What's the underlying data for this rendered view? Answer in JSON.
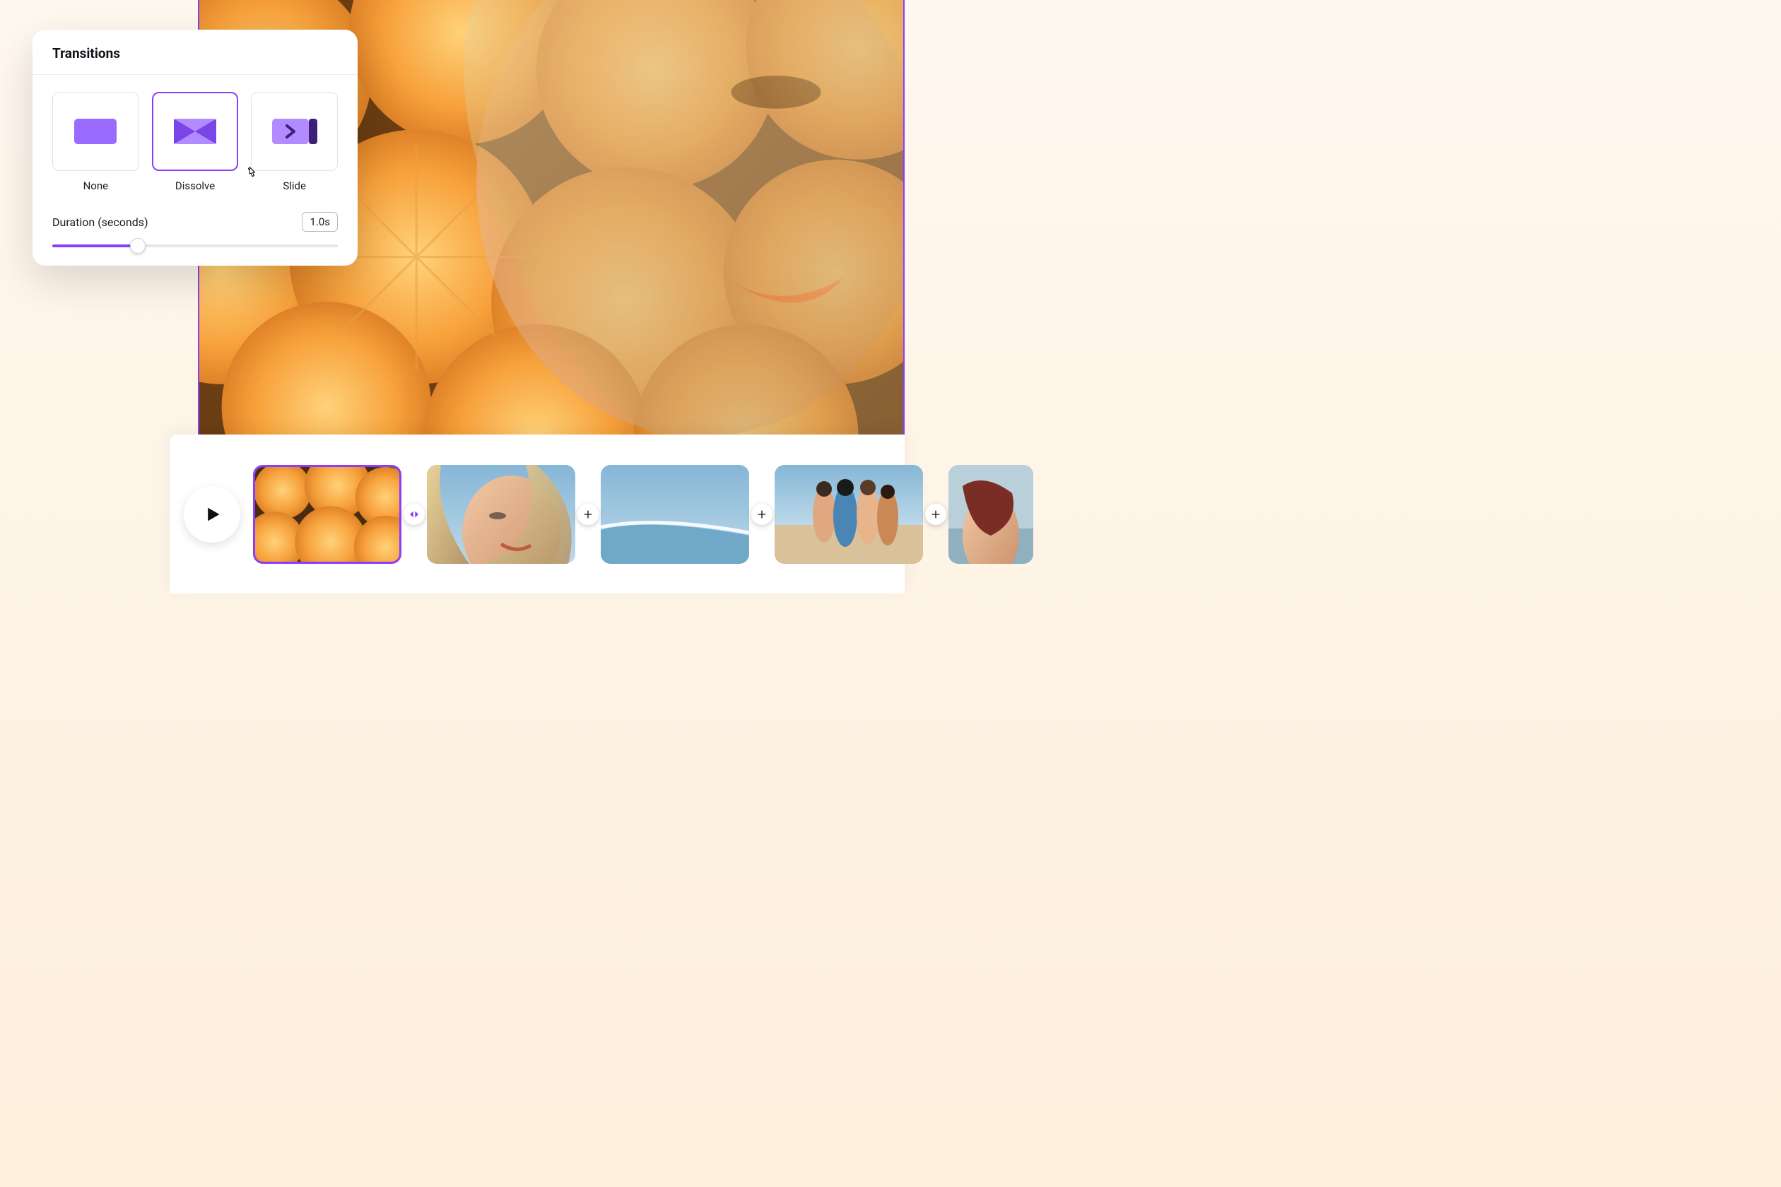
{
  "popover": {
    "title": "Transitions",
    "options": [
      {
        "label": "None",
        "selected": false
      },
      {
        "label": "Dissolve",
        "selected": true
      },
      {
        "label": "Slide",
        "selected": false
      }
    ],
    "duration_label": "Duration (seconds)",
    "duration_value": "1.0s",
    "slider_percent": 30
  },
  "timeline": {
    "play_icon": "play-icon",
    "clips": [
      {
        "name": "clip-oranges",
        "selected": true,
        "transition_after": "dissolve"
      },
      {
        "name": "clip-woman-portrait",
        "selected": false,
        "transition_after": "add"
      },
      {
        "name": "clip-ocean-wave",
        "selected": false,
        "transition_after": "add"
      },
      {
        "name": "clip-beach-group",
        "selected": false,
        "transition_after": "add"
      },
      {
        "name": "clip-woman-sea",
        "selected": false,
        "transition_after": null
      }
    ]
  },
  "colors": {
    "accent": "#8b3dff",
    "accent_light": "#b18bff"
  }
}
